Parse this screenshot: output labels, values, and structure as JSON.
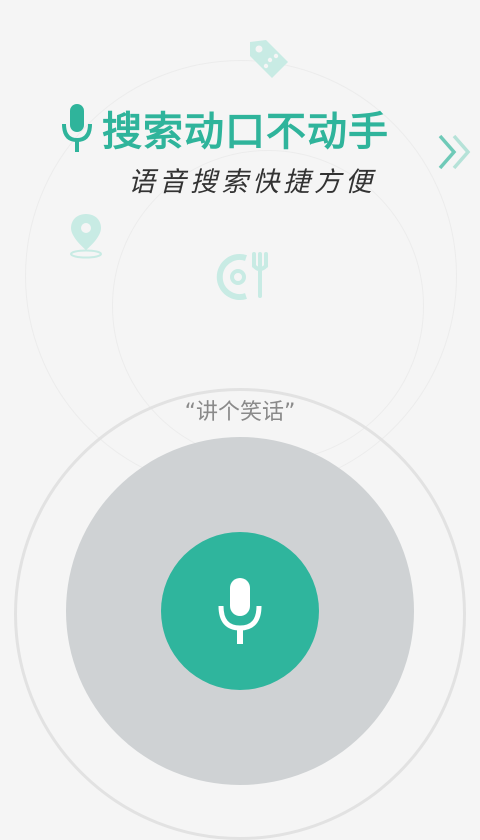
{
  "banner": {
    "title": "搜索动口不动手",
    "subtitle": "语音搜索快捷方便"
  },
  "voice": {
    "hint": "“讲个笑话”"
  },
  "colors": {
    "accent": "#2fb59d",
    "icon_tint": "#c8ebe4",
    "disc": "#cfd2d4",
    "background": "#f5f5f5"
  },
  "icons": [
    "tag-icon",
    "location-pin-icon",
    "dining-icon",
    "double-chevron-right-icon",
    "microphone-icon"
  ]
}
